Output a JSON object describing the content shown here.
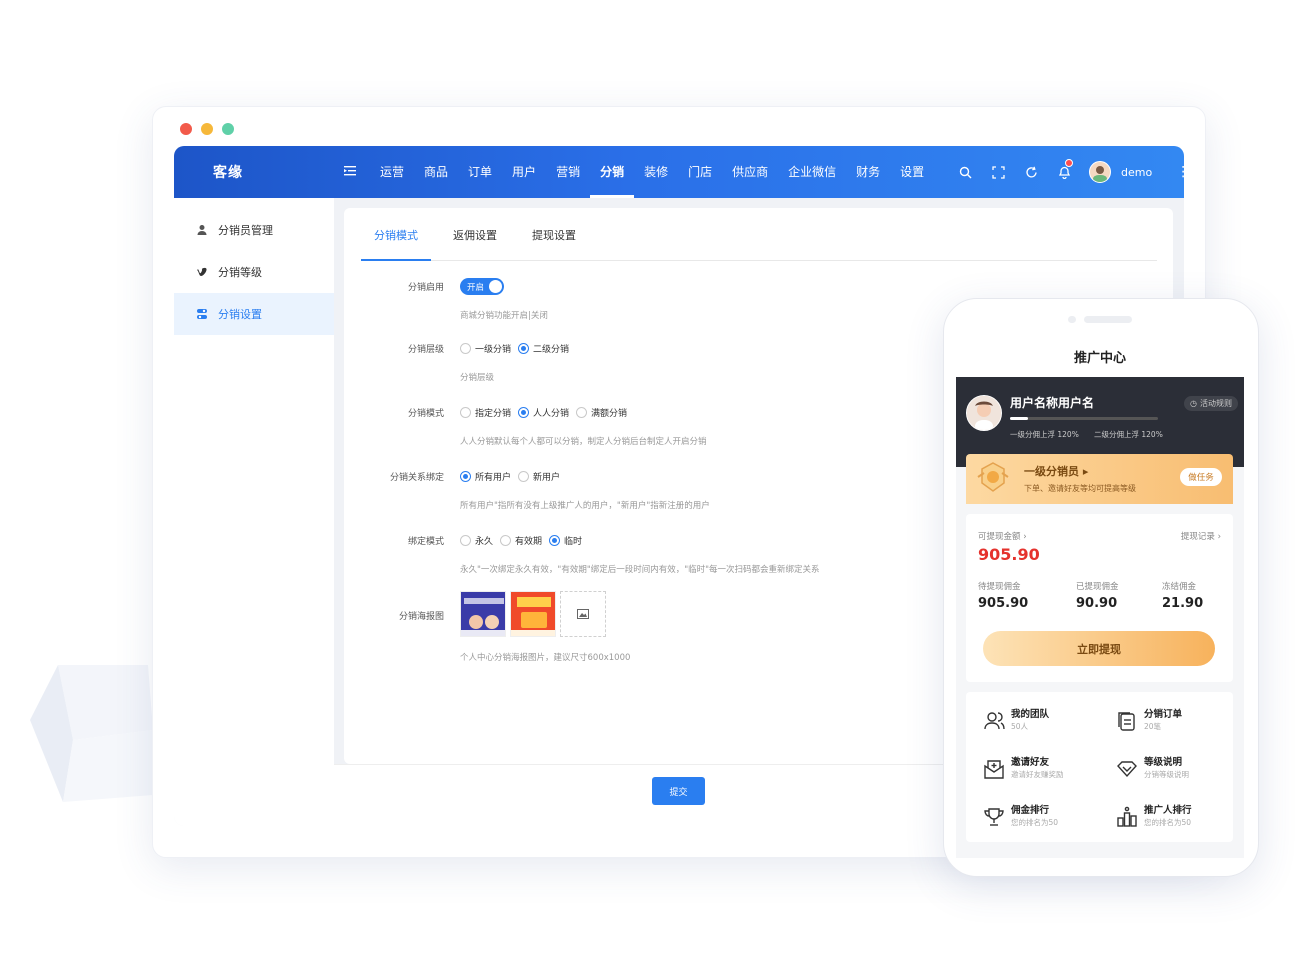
{
  "colors": {
    "primary": "#2a7ef0",
    "topbar": "#2a6fe8",
    "price": "#e5322d"
  },
  "window_controls": [
    "close-dot",
    "minimize-dot",
    "maximize-dot"
  ],
  "app": {
    "logo": "客缘"
  },
  "nav": [
    "运营",
    "商品",
    "订单",
    "用户",
    "营销",
    "分销",
    "装修",
    "门店",
    "供应商",
    "企业微信",
    "财务",
    "设置"
  ],
  "nav_active": "分销",
  "user": {
    "name": "demo"
  },
  "sidebar": [
    {
      "label": "分销员管理",
      "icon": "user-icon"
    },
    {
      "label": "分销等级",
      "icon": "vimeo-icon"
    },
    {
      "label": "分销设置",
      "icon": "settings-icon",
      "active": true
    }
  ],
  "tabs": [
    "分销模式",
    "返佣设置",
    "提现设置"
  ],
  "form": {
    "enable": {
      "label": "分销启用",
      "switch_text": "开启",
      "on": true,
      "hint": "商城分销功能开启|关闭"
    },
    "level": {
      "label": "分销层级",
      "options": [
        "一级分销",
        "二级分销"
      ],
      "selected": 1,
      "hint": "分销层级"
    },
    "mode": {
      "label": "分销模式",
      "options": [
        "指定分销",
        "人人分销",
        "满额分销"
      ],
      "selected": 1,
      "hint": "人人分销默认每个人都可以分销，制定人分销后台制定人开启分销"
    },
    "bind": {
      "label": "分销关系绑定",
      "options": [
        "所有用户",
        "新用户"
      ],
      "selected": 0,
      "hint": "所有用户\"指所有没有上级推广人的用户，\"新用户\"指新注册的用户"
    },
    "bind_mode": {
      "label": "绑定模式",
      "options": [
        "永久",
        "有效期",
        "临时"
      ],
      "selected": 2,
      "hint": "永久\"一次绑定永久有效，\"有效期\"绑定后一段时间内有效，\"临时\"每一次扫码都会重新绑定关系"
    },
    "poster": {
      "label": "分销海报图",
      "hint": "个人中心分销海报图片，建议尺寸600x1000"
    }
  },
  "submit_label": "提交",
  "phone": {
    "title": "推广中心",
    "user_name": "用户名称用户名",
    "rule": "活动规则",
    "level_progress": 0.12,
    "sub1": "一级分佣上浮 120%",
    "sub2": "二级分佣上浮 120%",
    "level_title": "一级分销员",
    "level_desc": "下单、邀请好友等均可提高等级",
    "task_btn": "做任务",
    "withdrawable_label": "可提现金额",
    "records": "提现记录",
    "withdrawable": "905.90",
    "stats": [
      {
        "label": "待提现佣金",
        "value": "905.90"
      },
      {
        "label": "已提现佣金",
        "value": "90.90"
      },
      {
        "label": "冻结佣金",
        "value": "21.90"
      }
    ],
    "cash_btn": "立即提现",
    "menu": [
      {
        "title": "我的团队",
        "desc": "50人",
        "icon": "team-icon"
      },
      {
        "title": "分销订单",
        "desc": "20笔",
        "icon": "order-icon"
      },
      {
        "title": "邀请好友",
        "desc": "邀请好友赚奖励",
        "icon": "invite-icon"
      },
      {
        "title": "等级说明",
        "desc": "分销等级说明",
        "icon": "diamond-icon"
      },
      {
        "title": "佣金排行",
        "desc": "您的排名为50",
        "icon": "trophy-icon"
      },
      {
        "title": "推广人排行",
        "desc": "您的排名为50",
        "icon": "ranking-icon"
      }
    ]
  }
}
